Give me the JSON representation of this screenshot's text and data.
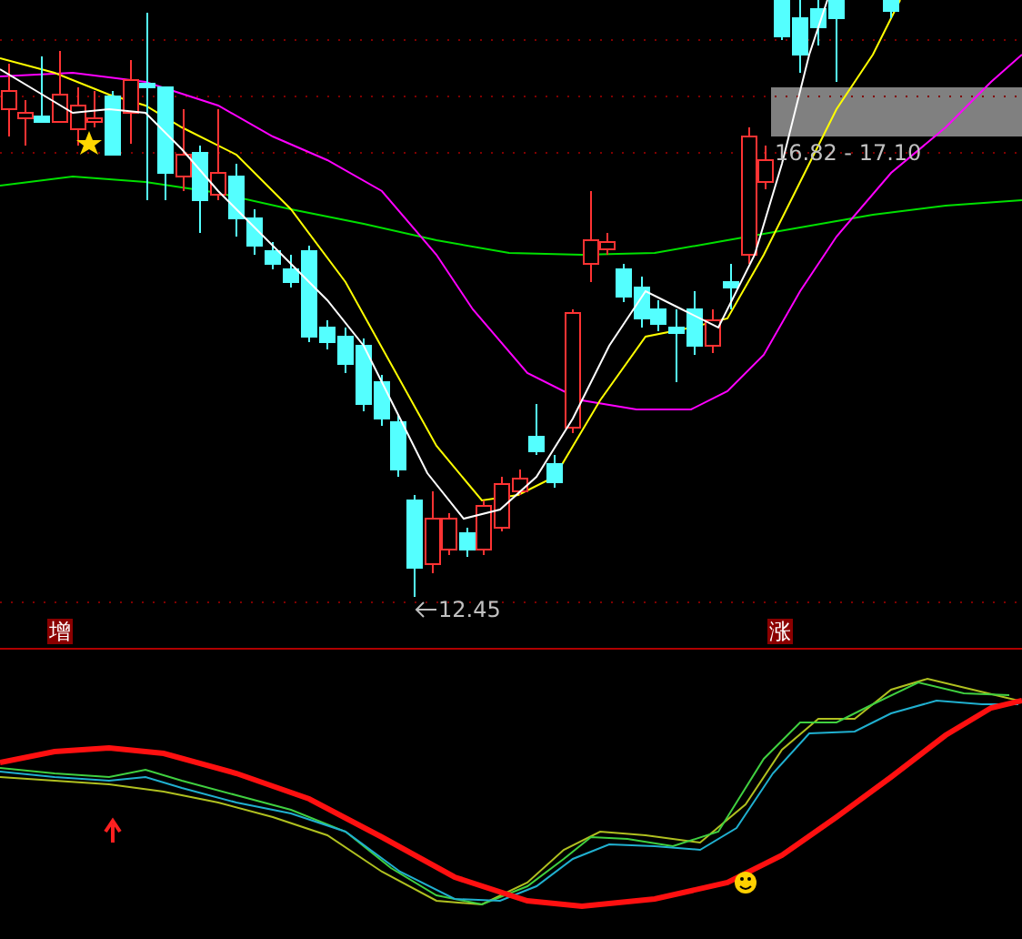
{
  "price_chart": {
    "range_label": "16.82 - 17.10",
    "low_label": "12.45"
  },
  "markers": [
    {
      "label": "增"
    },
    {
      "label": "涨"
    }
  ]
}
